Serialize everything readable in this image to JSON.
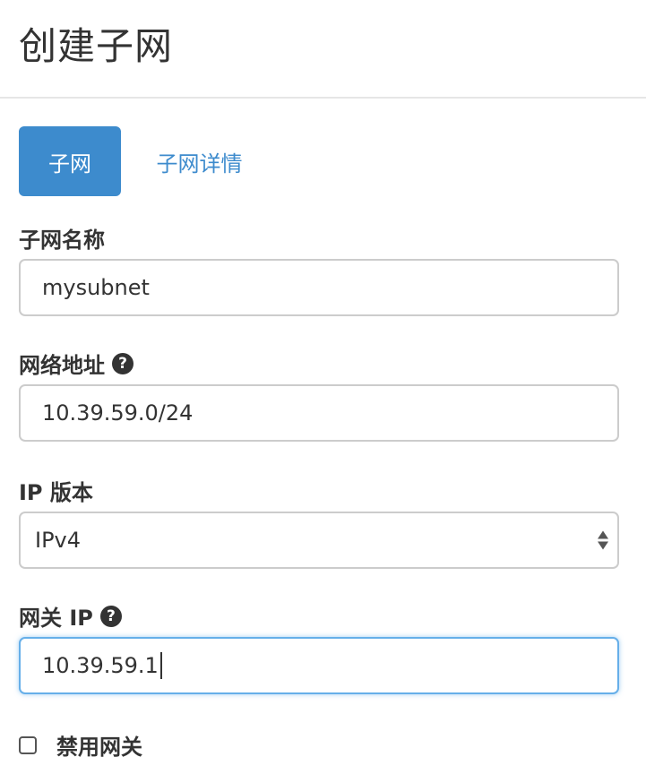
{
  "header": {
    "title": "创建子网"
  },
  "tabs": [
    {
      "label": "子网",
      "active": true
    },
    {
      "label": "子网详情",
      "active": false
    }
  ],
  "form": {
    "subnet_name": {
      "label": "子网名称",
      "value": "mysubnet"
    },
    "network_address": {
      "label": "网络地址",
      "value": "10.39.59.0/24",
      "help_icon": "question-circle-icon"
    },
    "ip_version": {
      "label": "IP 版本",
      "selected": "IPv4"
    },
    "gateway_ip": {
      "label": "网关 IP",
      "value": "10.39.59.1",
      "help_icon": "question-circle-icon"
    },
    "disable_gateway": {
      "label": "禁用网关",
      "checked": false
    }
  },
  "colors": {
    "accent": "#3d8bcd",
    "focus_border": "#66afe9",
    "text": "#333333",
    "border": "#cccccc"
  }
}
